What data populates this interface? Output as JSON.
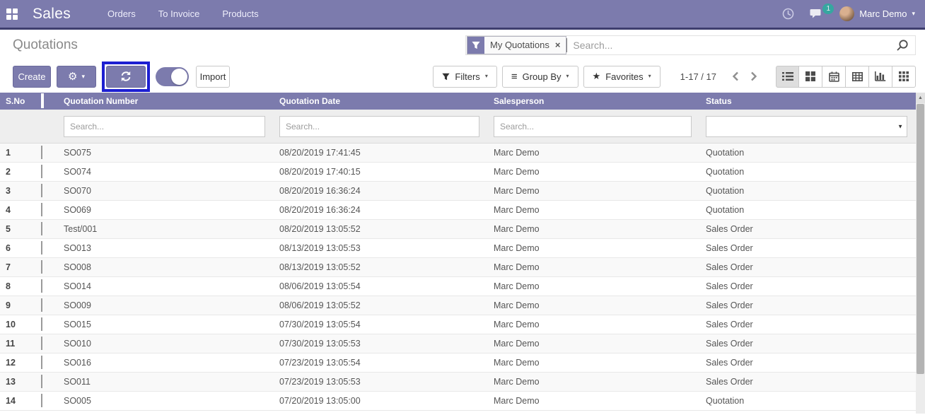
{
  "navbar": {
    "app_title": "Sales",
    "menu": [
      "Orders",
      "To Invoice",
      "Products"
    ],
    "user_name": "Marc Demo",
    "chat_badge": "1"
  },
  "control_panel": {
    "page_title": "Quotations",
    "search_facet": "My Quotations",
    "search_placeholder": "Search...",
    "create_label": "Create",
    "import_label": "Import",
    "filters_label": "Filters",
    "group_by_label": "Group By",
    "favorites_label": "Favorites",
    "pager_range": "1-17 / 17",
    "view_switcher": {
      "active": "list",
      "views": [
        "list",
        "kanban",
        "calendar",
        "pivot",
        "graph",
        "grid"
      ]
    }
  },
  "icons": {
    "gear": "⚙",
    "caret_down": "▾",
    "select_caret": "▼",
    "group_by": "≡",
    "star": "★",
    "close": "×",
    "scroll_up": "▲"
  },
  "colors": {
    "accent": "#7c7bad",
    "navbar_border": "#3e3e6e",
    "highlight_border": "#1d1fd1",
    "badge": "#2aaf9e"
  },
  "table": {
    "headers": {
      "sno": "S.No",
      "number": "Quotation Number",
      "date": "Quotation Date",
      "salesperson": "Salesperson",
      "status": "Status"
    },
    "column_filter_placeholder": "Search...",
    "rows": [
      {
        "sno": "1",
        "number": "SO075",
        "date": "08/20/2019 17:41:45",
        "salesperson": "Marc Demo",
        "status": "Quotation"
      },
      {
        "sno": "2",
        "number": "SO074",
        "date": "08/20/2019 17:40:15",
        "salesperson": "Marc Demo",
        "status": "Quotation"
      },
      {
        "sno": "3",
        "number": "SO070",
        "date": "08/20/2019 16:36:24",
        "salesperson": "Marc Demo",
        "status": "Quotation"
      },
      {
        "sno": "4",
        "number": "SO069",
        "date": "08/20/2019 16:36:24",
        "salesperson": "Marc Demo",
        "status": "Quotation"
      },
      {
        "sno": "5",
        "number": "Test/001",
        "date": "08/20/2019 13:05:52",
        "salesperson": "Marc Demo",
        "status": "Sales Order"
      },
      {
        "sno": "6",
        "number": "SO013",
        "date": "08/13/2019 13:05:53",
        "salesperson": "Marc Demo",
        "status": "Sales Order"
      },
      {
        "sno": "7",
        "number": "SO008",
        "date": "08/13/2019 13:05:52",
        "salesperson": "Marc Demo",
        "status": "Sales Order"
      },
      {
        "sno": "8",
        "number": "SO014",
        "date": "08/06/2019 13:05:54",
        "salesperson": "Marc Demo",
        "status": "Sales Order"
      },
      {
        "sno": "9",
        "number": "SO009",
        "date": "08/06/2019 13:05:52",
        "salesperson": "Marc Demo",
        "status": "Sales Order"
      },
      {
        "sno": "10",
        "number": "SO015",
        "date": "07/30/2019 13:05:54",
        "salesperson": "Marc Demo",
        "status": "Sales Order"
      },
      {
        "sno": "11",
        "number": "SO010",
        "date": "07/30/2019 13:05:53",
        "salesperson": "Marc Demo",
        "status": "Sales Order"
      },
      {
        "sno": "12",
        "number": "SO016",
        "date": "07/23/2019 13:05:54",
        "salesperson": "Marc Demo",
        "status": "Sales Order"
      },
      {
        "sno": "13",
        "number": "SO011",
        "date": "07/23/2019 13:05:53",
        "salesperson": "Marc Demo",
        "status": "Sales Order"
      },
      {
        "sno": "14",
        "number": "SO005",
        "date": "07/20/2019 13:05:00",
        "salesperson": "Marc Demo",
        "status": "Quotation"
      }
    ]
  }
}
